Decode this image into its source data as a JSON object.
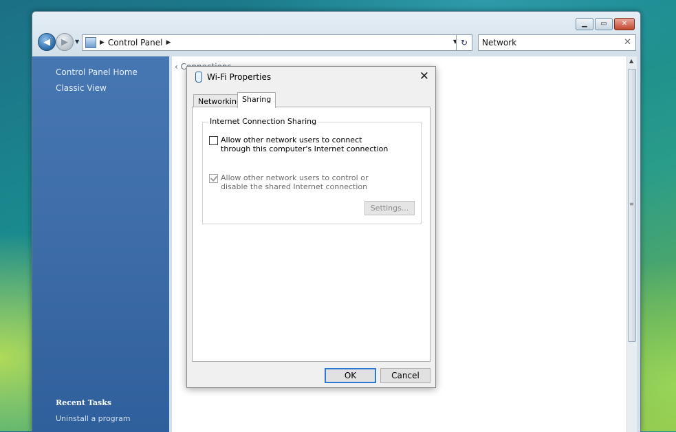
{
  "explorer": {
    "address": {
      "segment": "Control Panel"
    },
    "search": {
      "value": "Network"
    },
    "sidebar": {
      "links": [
        "Control Panel Home",
        "Classic View"
      ],
      "recent_tasks_title": "Recent Tasks",
      "recent_tasks": [
        "Uninstall a program"
      ]
    },
    "ghost_crumb": "‹ Connections"
  },
  "dialog": {
    "title": "Wi-Fi Properties",
    "tabs": [
      "Networking",
      "Sharing"
    ],
    "active_tab": "Sharing",
    "group_title": "Internet Connection Sharing",
    "allow_connect": {
      "label": "Allow other network users to connect through this computer's Internet connection",
      "checked": false
    },
    "allow_control": {
      "label": "Allow other network users to control or disable the shared Internet connection",
      "checked": true,
      "disabled": true
    },
    "settings_button": "Settings...",
    "ok_button": "OK",
    "cancel_button": "Cancel"
  }
}
